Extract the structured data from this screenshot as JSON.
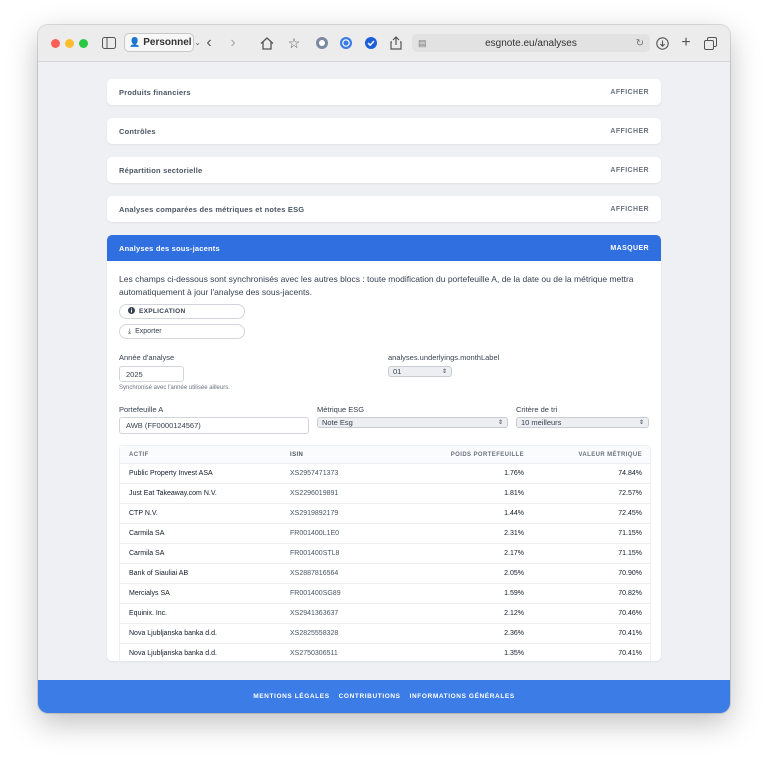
{
  "browser": {
    "profile_label": "Personnel",
    "url": "esgnote.eu/analyses"
  },
  "sections": [
    {
      "title": "Produits financiers",
      "action": "AFFICHER"
    },
    {
      "title": "Contrôles",
      "action": "AFFICHER"
    },
    {
      "title": "Répartition sectorielle",
      "action": "AFFICHER"
    },
    {
      "title": "Analyses comparées des métriques et notes ESG",
      "action": "AFFICHER"
    }
  ],
  "underlyings": {
    "title": "Analyses des sous-jacents",
    "action": "MASQUER",
    "description": "Les champs ci-dessous sont synchronisés avec les autres blocs : toute modification du portefeuille A, de la date ou de la métrique mettra automatiquement à jour l'analyse des sous-jacents.",
    "explanation_label": "EXPLICATION",
    "export_label": "Exporter",
    "year_label": "Année d'analyse",
    "year_value": "2025",
    "year_hint": "Synchronisé avec l'année utilisée ailleurs.",
    "month_label": "analyses.underlyings.monthLabel",
    "month_value": "01",
    "portfolio_label": "Portefeuille A",
    "portfolio_value": "AWB (FF0000124567)",
    "metric_label": "Métrique ESG",
    "metric_value": "Note Esg",
    "sort_label": "Critère de tri",
    "sort_value": "10 meilleurs",
    "table": {
      "headers": [
        "ACTIF",
        "ISIN",
        "POIDS PORTEFEUILLE",
        "VALEUR MÉTRIQUE"
      ],
      "rows": [
        [
          "Public Property Invest ASA",
          "XS2957471373",
          "1.76%",
          "74.84%"
        ],
        [
          "Just Eat Takeaway.com N.V.",
          "XS2296019891",
          "1.81%",
          "72.57%"
        ],
        [
          "CTP N.V.",
          "XS2919892179",
          "1.44%",
          "72.45%"
        ],
        [
          "Carmila SA",
          "FR001400L1E0",
          "2.31%",
          "71.15%"
        ],
        [
          "Carmila SA",
          "FR001400STL8",
          "2.17%",
          "71.15%"
        ],
        [
          "Bank of Siauliai AB",
          "XS2887816564",
          "2.05%",
          "70.90%"
        ],
        [
          "Mercialys SA",
          "FR001400SG89",
          "1.59%",
          "70.82%"
        ],
        [
          "Equinix. Inc.",
          "XS2941363637",
          "2.12%",
          "70.46%"
        ],
        [
          "Nova Ljubljanska banka d.d.",
          "XS2825558328",
          "2.36%",
          "70.41%"
        ],
        [
          "Nova Ljubljanska banka d.d.",
          "XS2750306511",
          "1.35%",
          "70.41%"
        ]
      ]
    }
  },
  "footer": {
    "links": [
      "MENTIONS LÉGALES",
      "CONTRIBUTIONS",
      "INFORMATIONS GÉNÉRALES"
    ]
  },
  "colors": {
    "accent": "#2f6fe0",
    "footer": "#3b7ce6"
  },
  "icons": [
    "sidebar-icon",
    "person-icon",
    "back-icon",
    "forward-icon",
    "home-icon",
    "star-icon",
    "extension-icon",
    "reader-icon",
    "download-icon",
    "new-tab-icon",
    "tabs-icon",
    "info-icon",
    "download-arrow-icon"
  ]
}
